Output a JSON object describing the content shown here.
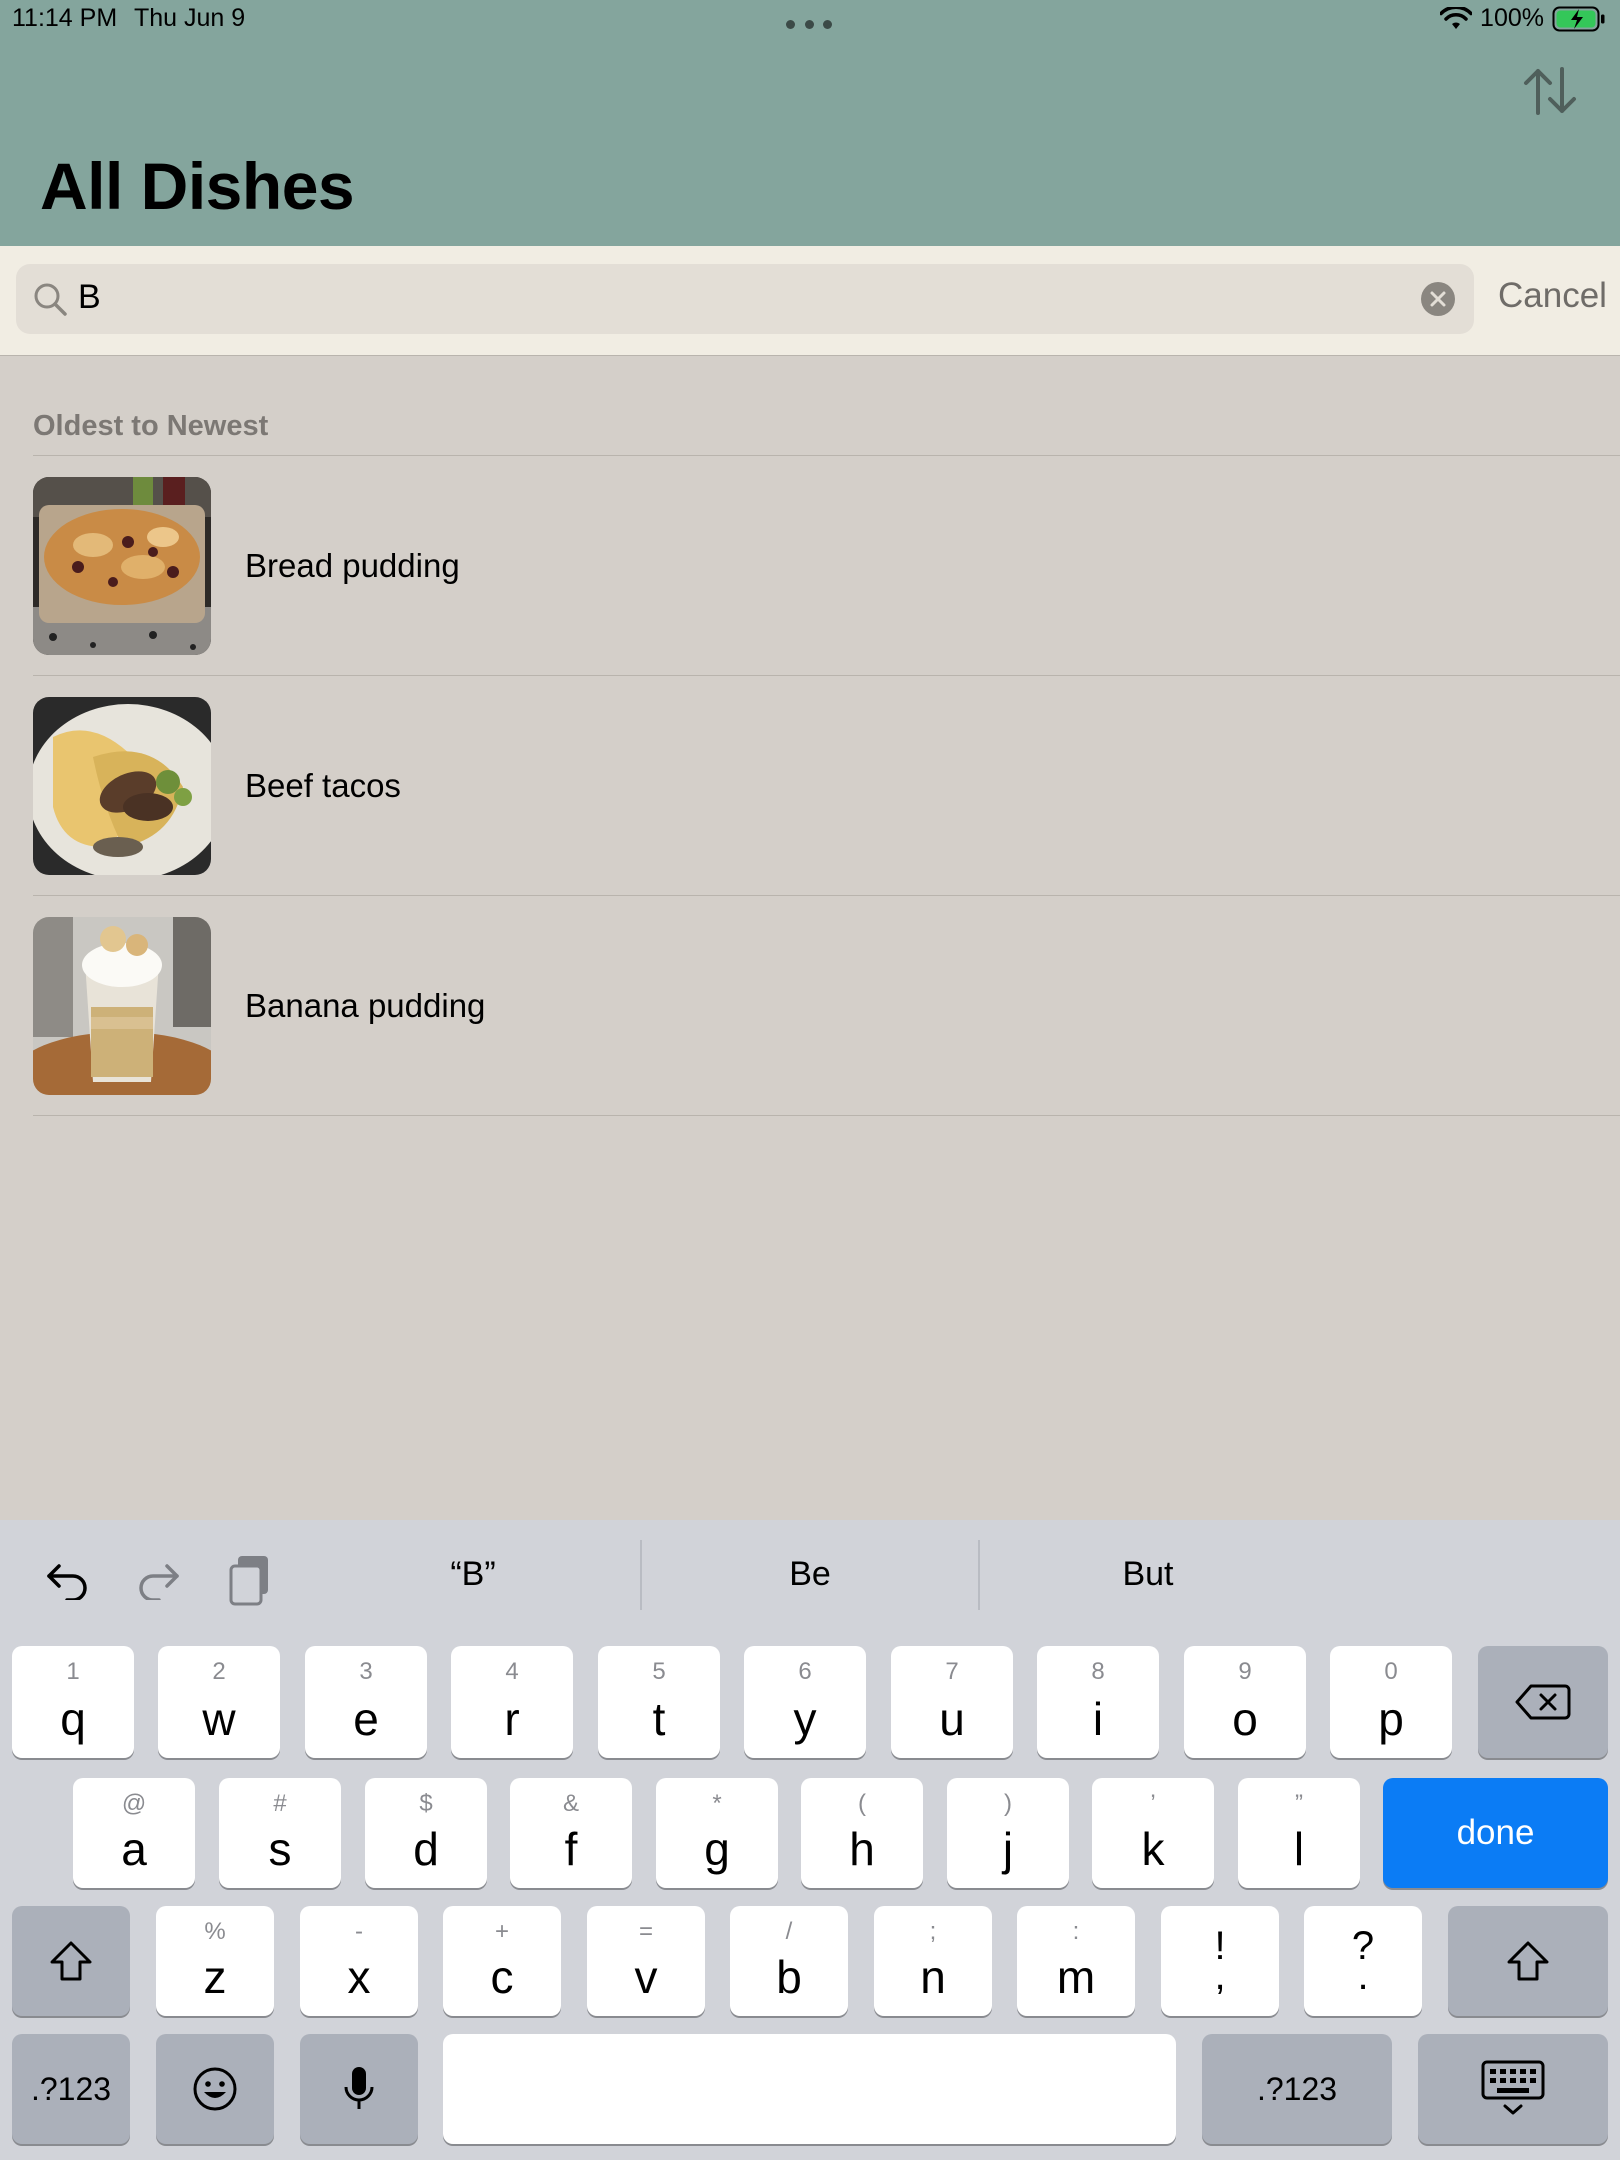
{
  "status_bar": {
    "time": "11:14 PM",
    "date": "Thu Jun 9",
    "battery": "100%"
  },
  "header": {
    "title": "All Dishes",
    "sort_icon": "sort-arrows-icon"
  },
  "search": {
    "value": "B",
    "cancel_label": "Cancel"
  },
  "section": {
    "header": "Oldest to Newest"
  },
  "dishes": [
    {
      "name": "Bread pudding"
    },
    {
      "name": "Beef tacos"
    },
    {
      "name": "Banana pudding"
    }
  ],
  "keyboard": {
    "suggestions": [
      "“B”",
      "Be",
      "But"
    ],
    "row1": [
      {
        "alt": "1",
        "key": "q"
      },
      {
        "alt": "2",
        "key": "w"
      },
      {
        "alt": "3",
        "key": "e"
      },
      {
        "alt": "4",
        "key": "r"
      },
      {
        "alt": "5",
        "key": "t"
      },
      {
        "alt": "6",
        "key": "y"
      },
      {
        "alt": "7",
        "key": "u"
      },
      {
        "alt": "8",
        "key": "i"
      },
      {
        "alt": "9",
        "key": "o"
      },
      {
        "alt": "0",
        "key": "p"
      }
    ],
    "row2": [
      {
        "alt": "@",
        "key": "a"
      },
      {
        "alt": "#",
        "key": "s"
      },
      {
        "alt": "$",
        "key": "d"
      },
      {
        "alt": "&",
        "key": "f"
      },
      {
        "alt": "*",
        "key": "g"
      },
      {
        "alt": "(",
        "key": "h"
      },
      {
        "alt": ")",
        "key": "j"
      },
      {
        "alt": "’",
        "key": "k"
      },
      {
        "alt": "”",
        "key": "l"
      }
    ],
    "row3": [
      {
        "alt": "%",
        "key": "z"
      },
      {
        "alt": "-",
        "key": "x"
      },
      {
        "alt": "+",
        "key": "c"
      },
      {
        "alt": "=",
        "key": "v"
      },
      {
        "alt": "/",
        "key": "b"
      },
      {
        "alt": ";",
        "key": "n"
      },
      {
        "alt": ":",
        "key": "m"
      }
    ],
    "punct1": {
      "top": "!",
      "bottom": ","
    },
    "punct2": {
      "top": "?",
      "bottom": "."
    },
    "done_label": "done",
    "numbers_label": ".?123"
  },
  "colors": {
    "header_bg": "#84a59d",
    "search_bg": "#f1ede3",
    "list_bg": "#d4cfc9",
    "accent": "#0b7cf5"
  }
}
